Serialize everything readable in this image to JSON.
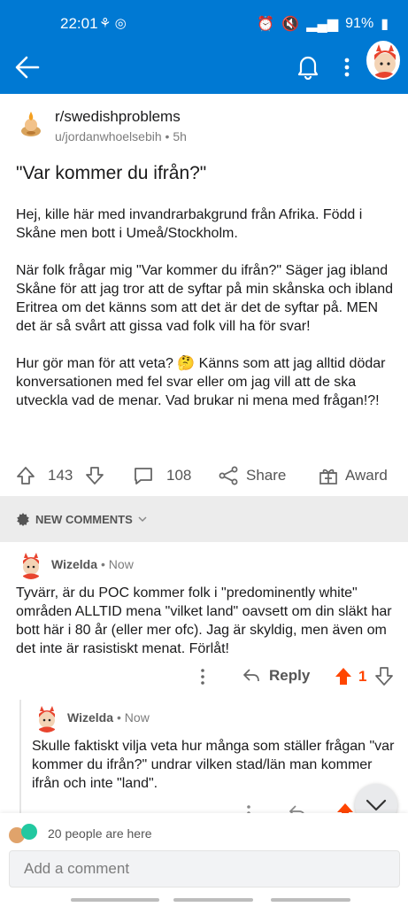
{
  "status_bar": {
    "time": "22:01",
    "battery": "91%"
  },
  "app_bar": {
    "back": "back",
    "notifications": "notifications",
    "more": "more"
  },
  "post": {
    "subreddit": "r/swedishproblems",
    "author": "u/jordanwhoelsebih",
    "age": "5h",
    "title": "\"Var kommer du ifrån?\"",
    "paragraphs": [
      "Hej, kille här med invandrarbakgrund från Afrika. Född i Skåne men bott i Umeå/Stockholm.",
      "När folk frågar mig \"Var kommer du ifrån?\" Säger jag ibland Skåne för att jag tror att de syftar på min skånska och ibland Eritrea om det känns som att det är det de syftar på. MEN det är så svårt att gissa vad folk vill ha för svar!",
      "Hur gör man för att veta? 🤔 Känns som att jag alltid dödar konversationen med fel svar eller om jag vill att de ska utveckla vad de menar. Vad brukar ni mena med frågan!?!"
    ],
    "upvotes": "143",
    "comments": "108",
    "share_label": "Share",
    "award_label": "Award"
  },
  "sort": {
    "label": "NEW COMMENTS"
  },
  "comments": [
    {
      "author": "Wizelda",
      "time": "Now",
      "text": "Tyvärr, är du POC kommer folk i \"predominently white\" områden ALLTID mena \"vilket land\" oavsett om din släkt har bott här i 80 år (eller mer ofc). Jag är skyldig, men även om det inte är rasistiskt menat. Förlåt!",
      "reply_label": "Reply",
      "score": "1"
    },
    {
      "author": "Wizelda",
      "time": "Now",
      "text": "Skulle faktiskt vilja veta hur många som ställer frågan \"var kommer du ifrån?\" undrar vilken stad/län man kommer ifrån och inte \"land\"."
    }
  ],
  "presence": {
    "text": "20 people are here"
  },
  "composer": {
    "placeholder": "Add a comment"
  },
  "colors": {
    "brand_blue": "#0079d3",
    "upvote_orange": "#ff4500"
  }
}
